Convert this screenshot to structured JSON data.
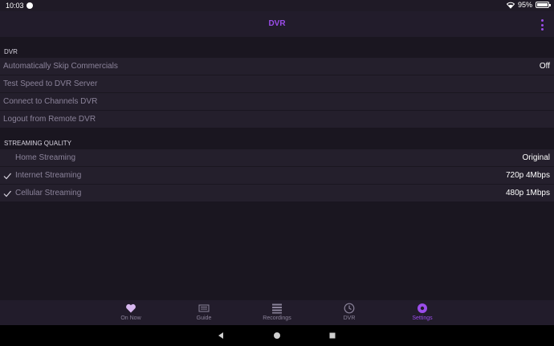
{
  "status": {
    "time": "10:03",
    "battery": "95%"
  },
  "header": {
    "title": "DVR"
  },
  "sections": {
    "dvr": {
      "title": "DVR",
      "rows": [
        {
          "label": "Automatically Skip Commercials",
          "value": "Off"
        },
        {
          "label": "Test Speed to DVR Server"
        },
        {
          "label": "Connect to Channels DVR"
        },
        {
          "label": "Logout from Remote DVR"
        }
      ]
    },
    "streaming": {
      "title": "STREAMING QUALITY",
      "rows": [
        {
          "label": "Home Streaming",
          "value": "Original",
          "checked": false
        },
        {
          "label": "Internet Streaming",
          "value": "720p 4Mbps",
          "checked": true
        },
        {
          "label": "Cellular Streaming",
          "value": "480p 1Mbps",
          "checked": true
        }
      ]
    }
  },
  "nav": {
    "items": [
      {
        "label": "On Now",
        "icon": "heart-icon"
      },
      {
        "label": "Guide",
        "icon": "guide-icon"
      },
      {
        "label": "Recordings",
        "icon": "list-icon"
      },
      {
        "label": "DVR",
        "icon": "clock-icon"
      },
      {
        "label": "Settings",
        "icon": "gear-icon",
        "active": true
      }
    ]
  },
  "colors": {
    "accent": "#9b4dea",
    "background": "#1a1620",
    "row": "#241f2c",
    "bar": "#221c2b"
  }
}
